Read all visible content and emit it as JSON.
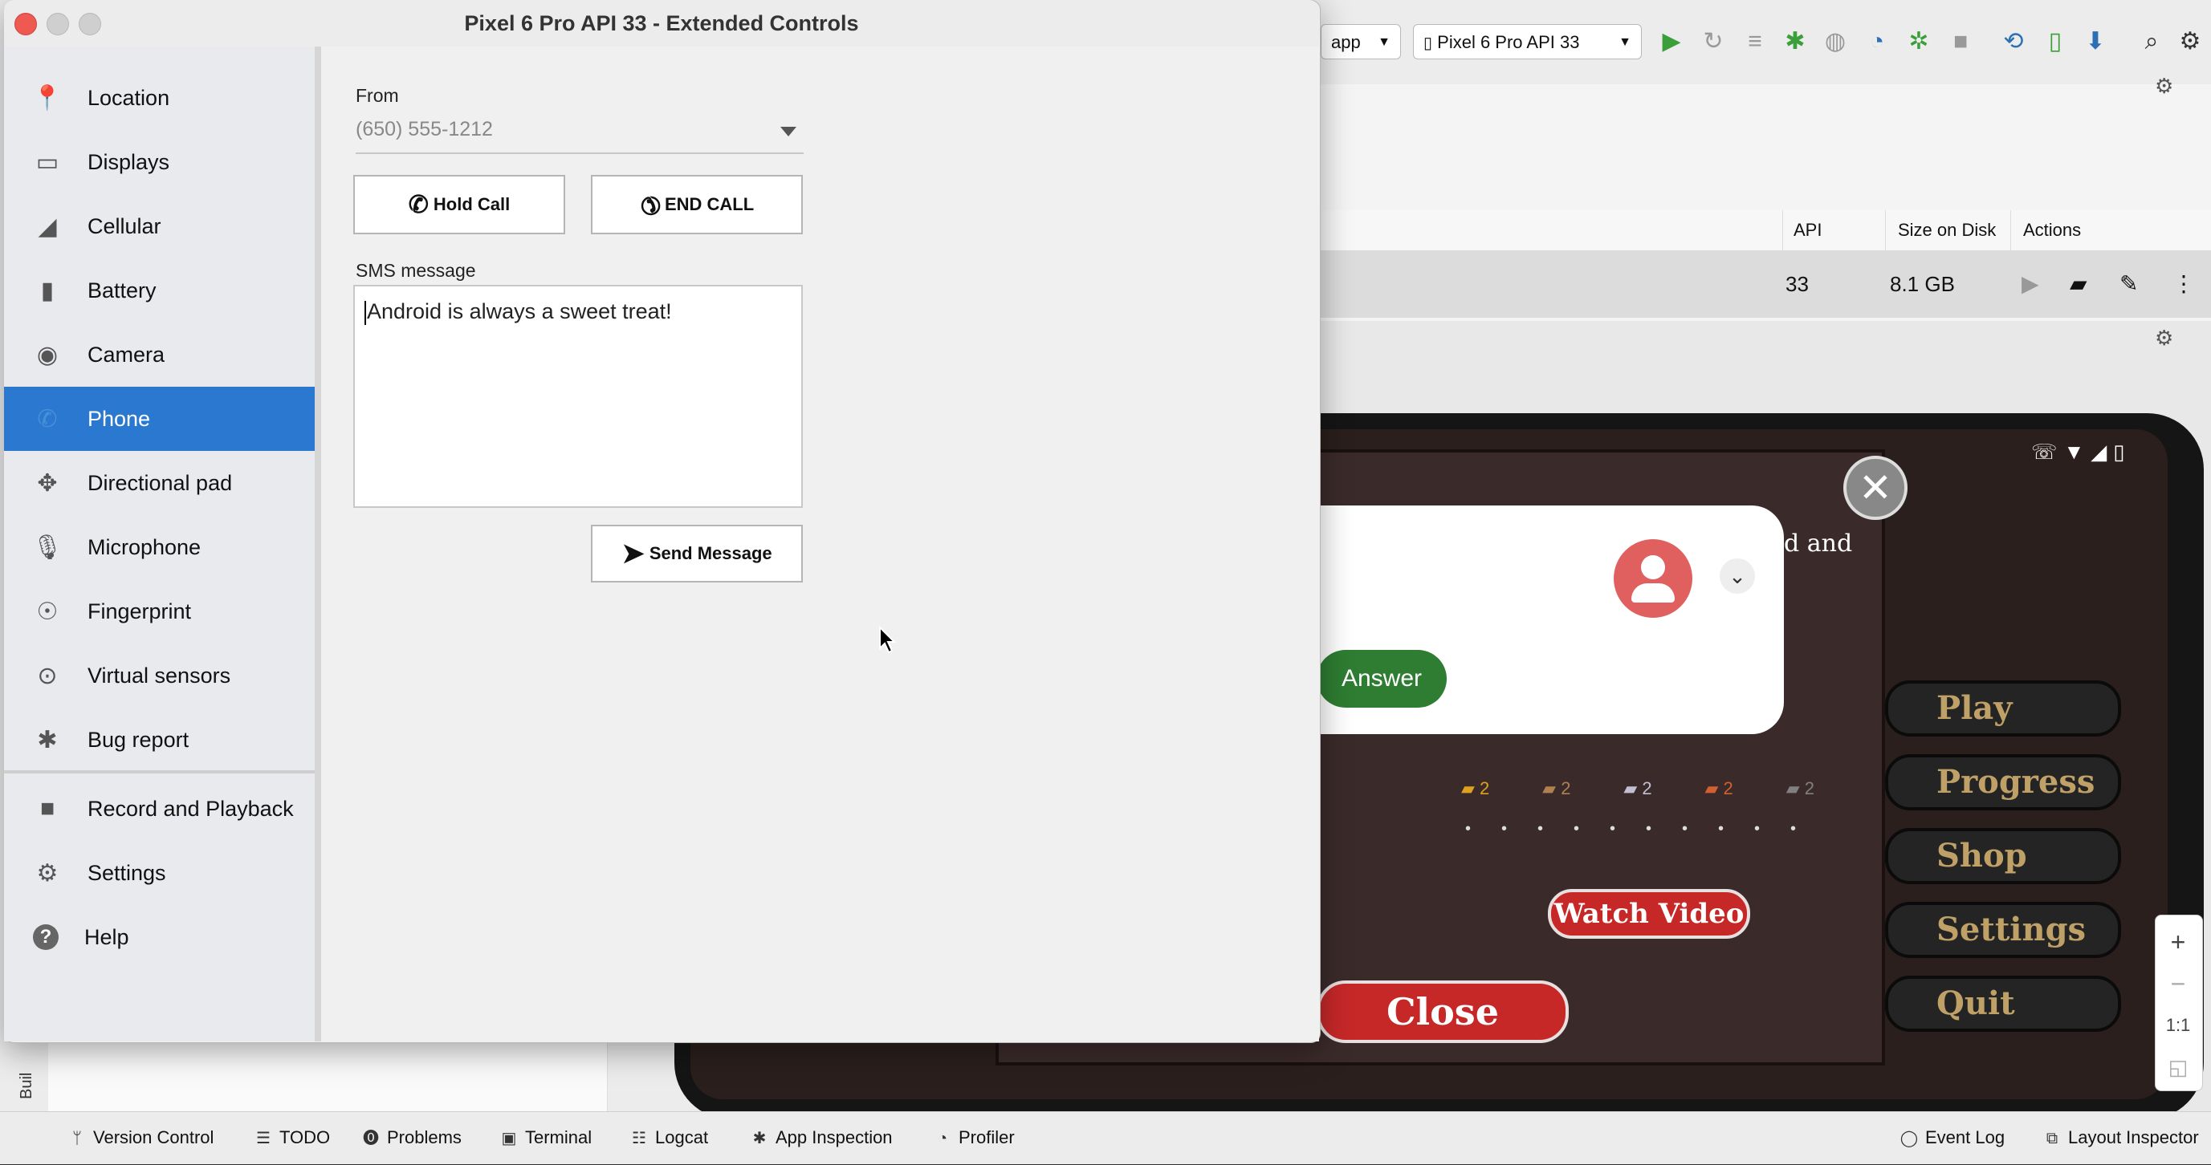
{
  "window": {
    "title": "Pixel 6 Pro API 33 - Extended Controls"
  },
  "sidebar": {
    "items": [
      {
        "label": "Location",
        "icon": "location-pin-icon",
        "active": false
      },
      {
        "label": "Displays",
        "icon": "display-icon",
        "active": false
      },
      {
        "label": "Cellular",
        "icon": "signal-icon",
        "active": false
      },
      {
        "label": "Battery",
        "icon": "battery-icon",
        "active": false
      },
      {
        "label": "Camera",
        "icon": "camera-icon",
        "active": false
      },
      {
        "label": "Phone",
        "icon": "phone-icon",
        "active": true
      },
      {
        "label": "Directional pad",
        "icon": "dpad-icon",
        "active": false
      },
      {
        "label": "Microphone",
        "icon": "microphone-icon",
        "active": false
      },
      {
        "label": "Fingerprint",
        "icon": "fingerprint-icon",
        "active": false
      },
      {
        "label": "Virtual sensors",
        "icon": "sensors-icon",
        "active": false
      },
      {
        "label": "Bug report",
        "icon": "bug-icon",
        "active": false
      },
      {
        "label": "Record and Playback",
        "icon": "video-camera-icon",
        "active": false
      },
      {
        "label": "Settings",
        "icon": "gear-icon",
        "active": false
      },
      {
        "label": "Help",
        "icon": "help-icon",
        "active": false
      }
    ],
    "active_color": "#2a78d0"
  },
  "phone_panel": {
    "from_label": "From",
    "from_value": "(650) 555-1212",
    "hold_call_label": "Hold Call",
    "end_call_label": "END CALL",
    "sms_label": "SMS message",
    "sms_text": "Android is always a sweet treat!",
    "send_label": "Send Message"
  },
  "ide": {
    "run_config": "app",
    "device": "Pixel 6 Pro API 33",
    "table_headers": {
      "api": "API",
      "size": "Size on Disk",
      "actions": "Actions"
    },
    "device_row": {
      "api": "33",
      "size": "8.1 GB"
    }
  },
  "emulator": {
    "notification": {
      "answer_label": "Answer",
      "partial_text": "d and"
    },
    "game_menu": [
      "Play",
      "Progress",
      "Shop",
      "Settings",
      "Quit"
    ],
    "watch_video_label": "Watch Video",
    "close_label": "Close",
    "resource_counts": [
      "2",
      "2",
      "2",
      "2",
      "2"
    ],
    "zoom_controls": [
      "+",
      "−",
      "1:1"
    ]
  },
  "bottom_bar": {
    "items": [
      "Version Control",
      "TODO",
      "Problems",
      "Terminal",
      "Logcat",
      "App Inspection",
      "Profiler"
    ],
    "right_items": [
      "Event Log",
      "Layout Inspector"
    ],
    "side_tab": "Buil"
  }
}
